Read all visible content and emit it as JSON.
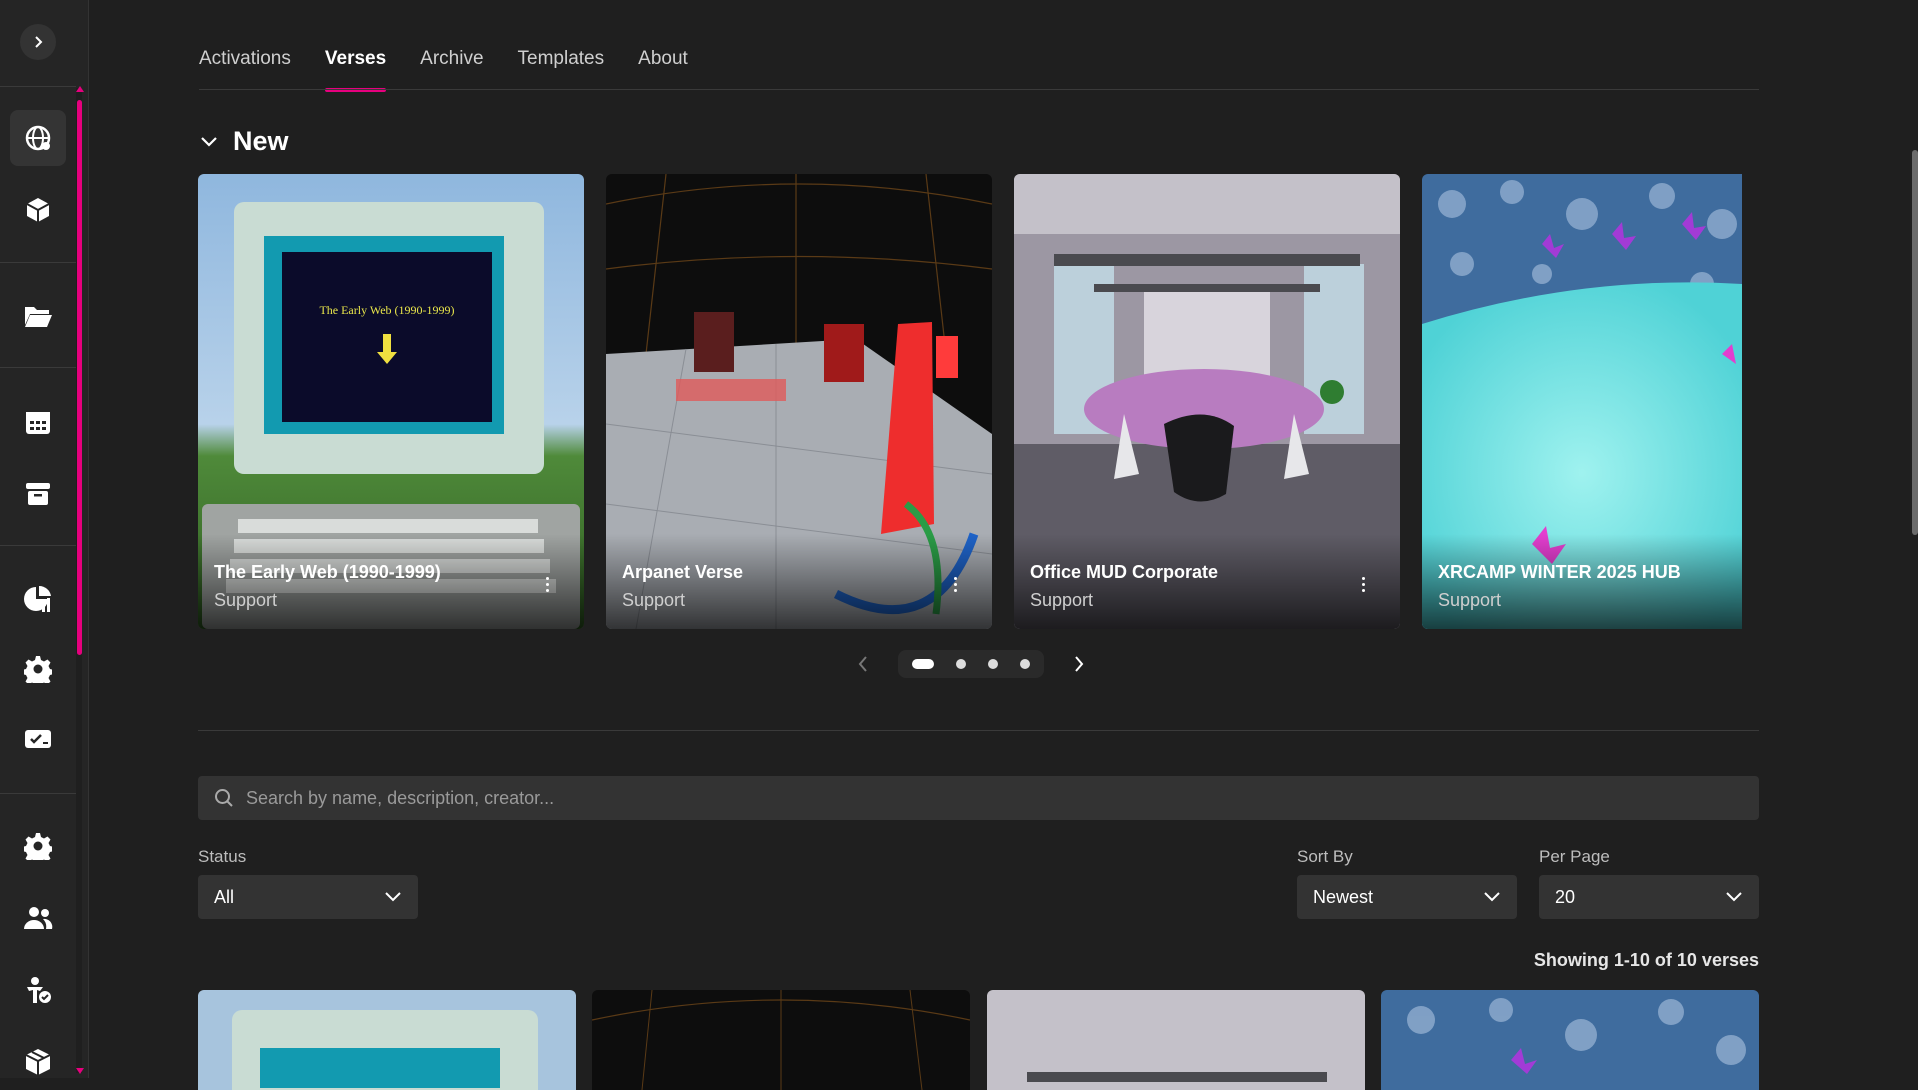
{
  "sidebar": {
    "toggle_icon": "chevron-right-icon",
    "items": [
      {
        "name": "globe-network-icon",
        "active": true
      },
      {
        "name": "cube-icon"
      },
      {
        "name": "folder-open-icon"
      },
      {
        "name": "calendar-grid-icon"
      },
      {
        "name": "archive-box-icon"
      },
      {
        "name": "analytics-pie-icon"
      },
      {
        "name": "gear-icon"
      },
      {
        "name": "ticket-icon"
      },
      {
        "name": "settings-gear-icon"
      },
      {
        "name": "users-icon"
      },
      {
        "name": "user-check-icon"
      },
      {
        "name": "package-icon"
      }
    ],
    "accent": "#e6007e"
  },
  "tabs": [
    {
      "label": "Activations"
    },
    {
      "label": "Verses",
      "active": true
    },
    {
      "label": "Archive"
    },
    {
      "label": "Templates"
    },
    {
      "label": "About"
    }
  ],
  "new_section": {
    "title": "New",
    "cards": [
      {
        "title": "The Early Web (1990-1999)",
        "subtitle": "Support"
      },
      {
        "title": "Arpanet Verse",
        "subtitle": "Support"
      },
      {
        "title": "Office MUD Corporate",
        "subtitle": "Support"
      },
      {
        "title": "XRCAMP WINTER 2025 HUB",
        "subtitle": "Support"
      }
    ],
    "pager": {
      "pages": 4,
      "current": 1
    }
  },
  "search": {
    "placeholder": "Search by name, description, creator..."
  },
  "filters": {
    "status": {
      "label": "Status",
      "value": "All"
    },
    "sort_by": {
      "label": "Sort By",
      "value": "Newest"
    },
    "per_page": {
      "label": "Per Page",
      "value": "20"
    }
  },
  "results": {
    "summary": "Showing 1-10 of 10 verses"
  }
}
